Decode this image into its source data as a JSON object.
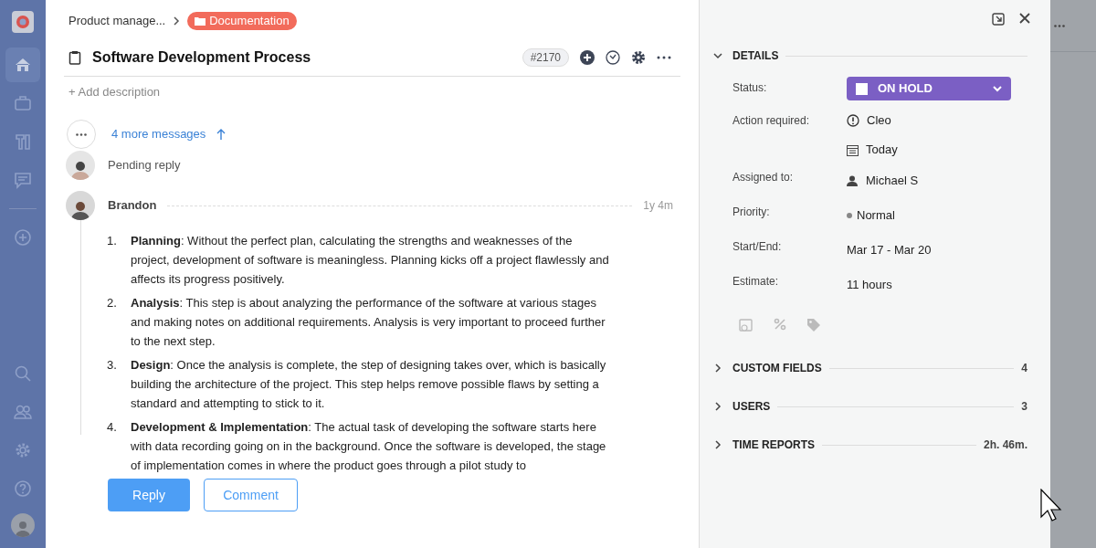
{
  "nav": {
    "top": [
      {
        "kind": "home",
        "selected": true
      },
      {
        "kind": "briefcase",
        "selected": false
      },
      {
        "kind": "tools",
        "selected": false
      },
      {
        "kind": "chat",
        "selected": false
      },
      {
        "kind": "add",
        "selected": false
      }
    ],
    "bottom": [
      {
        "kind": "search",
        "selected": false
      },
      {
        "kind": "users",
        "selected": false
      },
      {
        "kind": "settings",
        "selected": false
      },
      {
        "kind": "help",
        "selected": false
      }
    ]
  },
  "breadcrumb": {
    "parent": "Product manage...",
    "current": "Documentation",
    "color": "#f26b5b"
  },
  "task": {
    "title": "Software Development Process",
    "number": "#2170",
    "add_description": "+ Add description"
  },
  "thread": {
    "more": "4 more messages",
    "pending": "Pending reply",
    "message": {
      "author": "Brandon",
      "time": "1y 4m",
      "items": [
        {
          "num": "1.",
          "text": "**Planning**: Without the perfect plan, calculating the strengths and weaknesses of the project, development of software is meaningless. Planning kicks off a project flawlessly and affects its progress positively."
        },
        {
          "num": "2.",
          "text": "**Analysis**: This step is about analyzing the performance of the software at various stages and making notes on additional requirements. Analysis is very important to proceed further to the next step."
        },
        {
          "num": "3.",
          "text": "**Design**: Once the analysis is complete, the step of designing takes over, which is basically building the architecture of the project. This step helps remove possible flaws by setting a standard and attempting to stick to it."
        },
        {
          "num": "4.",
          "text": "**Development & Implementation**: The actual task of developing the software starts here with data recording going on in the background. Once the software is developed, the stage of implementation comes in where the product goes through a pilot study to"
        }
      ]
    }
  },
  "buttons": {
    "reply": "Reply",
    "comment": "Comment"
  },
  "details": {
    "heading": "DETAILS",
    "expanded": true,
    "fields": [
      {
        "kind": "status",
        "label": "Status:",
        "value": "ON HOLD",
        "color": "#7b5fc4"
      },
      {
        "kind": "action",
        "label": "Action required:",
        "value": "Cleo",
        "due": "Today"
      },
      {
        "kind": "user",
        "label": "Assigned to:",
        "value": "Michael S"
      },
      {
        "kind": "priority",
        "label": "Priority:",
        "value": "Normal",
        "color": "#888888"
      },
      {
        "kind": "text",
        "label": "Start/End:",
        "value": "Mar 17 - Mar 20"
      },
      {
        "kind": "text",
        "label": "Estimate:",
        "value": "11 hours"
      }
    ]
  },
  "sections": [
    {
      "title": "CUSTOM FIELDS",
      "count": "4",
      "expanded": false
    },
    {
      "title": "USERS",
      "count": "3",
      "expanded": false
    },
    {
      "title": "TIME REPORTS",
      "count": "2h. 46m.",
      "expanded": false
    }
  ]
}
